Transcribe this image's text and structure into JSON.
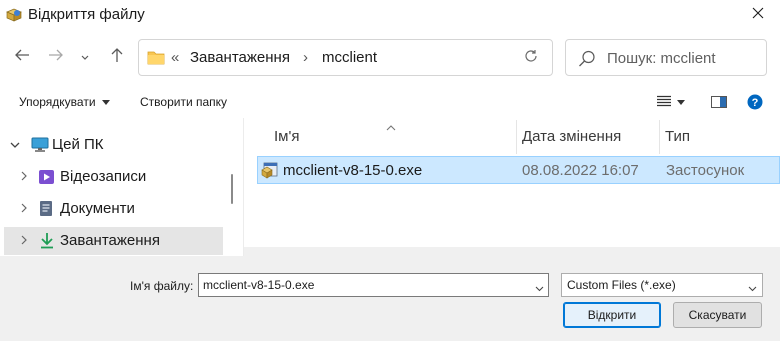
{
  "window": {
    "title": "Відкриття файлу",
    "close_glyph": "✕"
  },
  "address": {
    "overflow": "«",
    "segments": [
      "Завантаження",
      "mcclient"
    ],
    "separator": "›"
  },
  "search": {
    "placeholder": "Пошук: mcclient"
  },
  "commandbar": {
    "organize": "Упорядкувати",
    "new_folder": "Створити папку"
  },
  "nav": {
    "items": [
      {
        "label": "Цей ПК",
        "expanded": true,
        "icon": "monitor-icon"
      },
      {
        "label": "Відеозаписи",
        "expanded": false,
        "icon": "video-icon"
      },
      {
        "label": "Документи",
        "expanded": false,
        "icon": "document-icon"
      },
      {
        "label": "Завантаження",
        "expanded": false,
        "selected": true,
        "icon": "download-icon"
      }
    ]
  },
  "list": {
    "columns": [
      "Ім'я",
      "Дата змінення",
      "Тип"
    ],
    "rows": [
      {
        "name": "mcclient-v8-15-0.exe",
        "date": "08.08.2022 16:07",
        "type": "Застосунок",
        "selected": true
      }
    ]
  },
  "bottom": {
    "filename_label": "Ім'я файлу:",
    "filename_value": "mcclient-v8-15-0.exe",
    "filter_value": "Custom Files (*.exe)",
    "open_label": "Відкрити",
    "cancel_label": "Скасувати"
  },
  "colors": {
    "selection": "#cce8ff",
    "selection_border": "#99d1ff",
    "accent": "#0078d7",
    "help": "#0067c0"
  }
}
